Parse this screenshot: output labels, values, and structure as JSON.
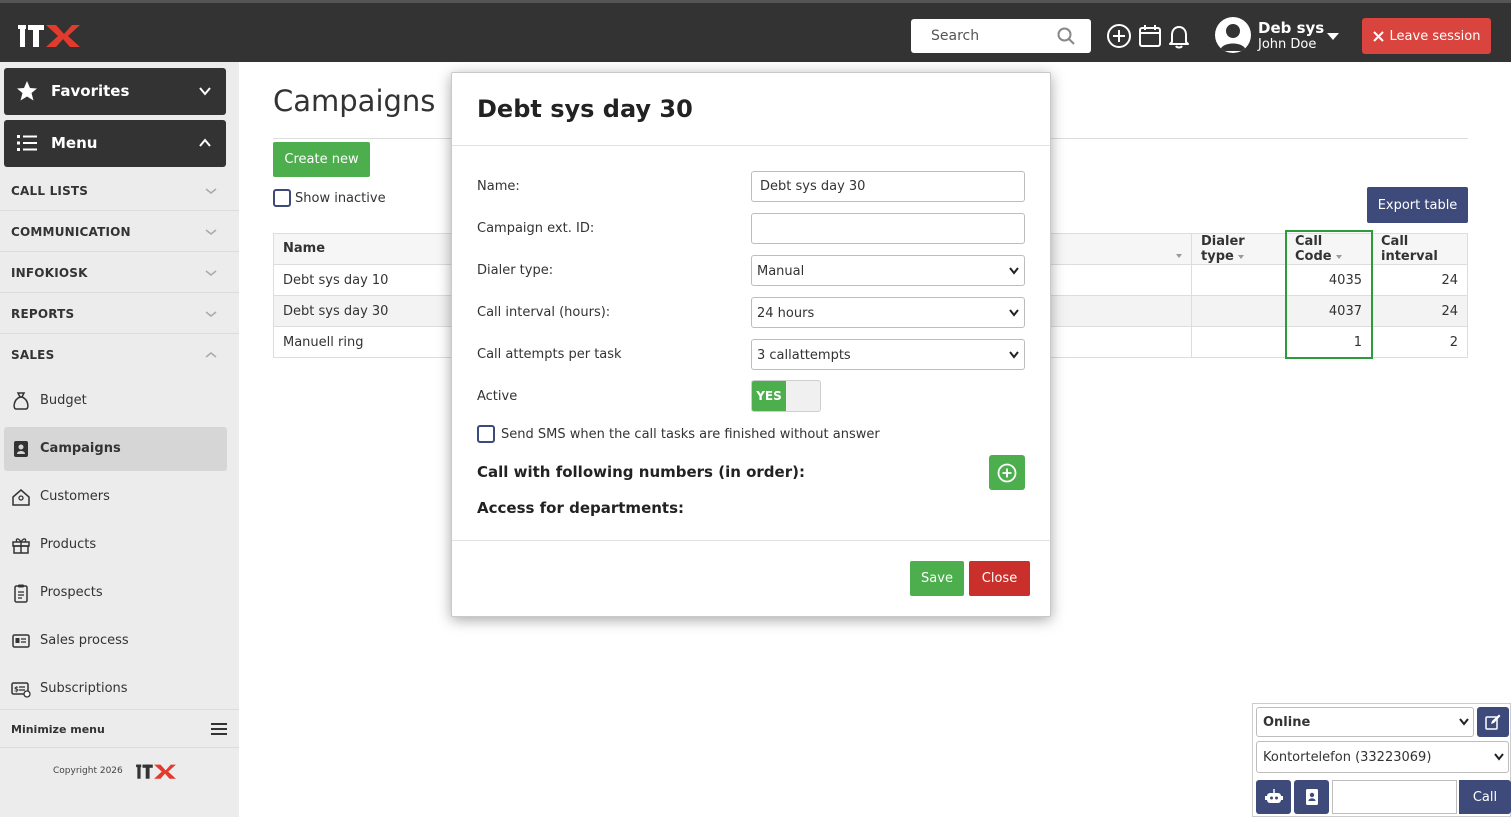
{
  "header": {
    "search_placeholder": "Search",
    "user_name": "Deb sys",
    "user_sub": "John Doe",
    "leave_label": "Leave session"
  },
  "sidebar": {
    "favorites": "Favorites",
    "menu": "Menu",
    "sections": [
      "CALL LISTS",
      "COMMUNICATION",
      "INFOKIOSK",
      "REPORTS",
      "SALES"
    ],
    "items": [
      "Budget",
      "Campaigns",
      "Customers",
      "Products",
      "Prospects",
      "Sales process",
      "Subscriptions"
    ],
    "active_item": "Campaigns",
    "minimize": "Minimize menu",
    "copyright": "Copyright 2026"
  },
  "main": {
    "title": "Campaigns",
    "create_label": "Create new",
    "show_inactive": "Show inactive",
    "export_label": "Export table",
    "table": {
      "columns": [
        "Name",
        "Dialer type",
        "Call Code",
        "Call interval"
      ],
      "rows": [
        {
          "name": "Debt sys day 10",
          "dialer": "",
          "code": "4035",
          "interval": "24"
        },
        {
          "name": "Debt sys day 30",
          "dialer": "",
          "code": "4037",
          "interval": "24"
        },
        {
          "name": "Manuell ring",
          "dialer": "",
          "code": "1",
          "interval": "2"
        }
      ]
    }
  },
  "modal": {
    "title": "Debt sys day 30",
    "name_label": "Name:",
    "name_value": "Debt sys day 30",
    "ext_label": "Campaign ext. ID:",
    "ext_value": "",
    "dialer_label": "Dialer type:",
    "dialer_value": "Manual",
    "interval_label": "Call interval (hours):",
    "interval_value": "24 hours",
    "attempts_label": "Call attempts per task",
    "attempts_value": "3 callattempts",
    "active_label": "Active",
    "active_value": "YES",
    "sms_label": "Send SMS when the call tasks are finished without answer",
    "numbers_label": "Call with following numbers (in order):",
    "departments_label": "Access for departments:",
    "save_label": "Save",
    "close_label": "Close"
  },
  "phone": {
    "status": "Online",
    "line": "Kontortelefon (33223069)",
    "number": "",
    "call_label": "Call"
  },
  "colors": {
    "topbar": "#333333",
    "green": "#4cae4c",
    "red": "#d9443e",
    "navy": "#3d4a7a"
  }
}
